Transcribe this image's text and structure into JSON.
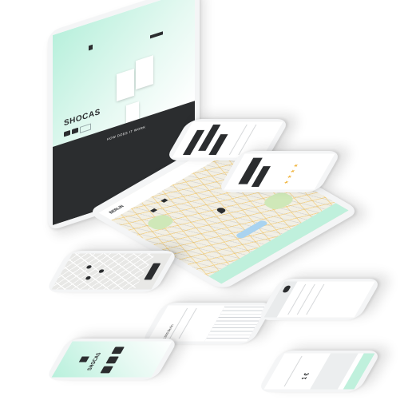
{
  "laptop": {
    "brand": "SHOCAS",
    "cta_label": "HOW DOES IT WORK"
  },
  "map_tablet": {
    "city": "BERLIN"
  },
  "phone_brand": {
    "brand": "SHOCAS"
  },
  "phone_keyboard": {
    "field_value": "1000 Berlin"
  },
  "phone_form": {
    "amount": "1 €"
  },
  "colors": {
    "brand_mint": "#a8ecd3",
    "dark": "#2b2d2f",
    "map_bg": "#f2efe4",
    "rating_yellow": "#f0b43c"
  }
}
